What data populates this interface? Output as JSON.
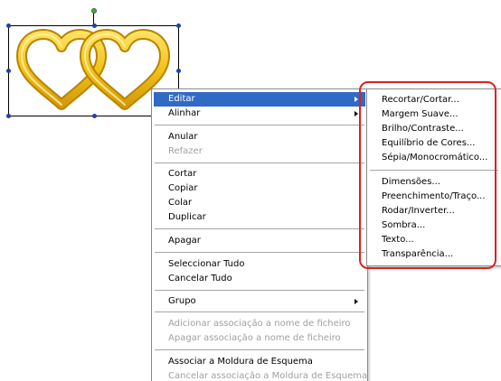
{
  "colors": {
    "highlight": "#316ac5",
    "annotation": "#e0201f",
    "heart_gold": "#f2c21a"
  },
  "canvas_object": {
    "icon": "double-heart-shape"
  },
  "main_menu": {
    "items": [
      {
        "label": "Editar",
        "highlighted": true,
        "submenu": true
      },
      {
        "label": "Alinhar",
        "submenu": true
      },
      {
        "label": "Anular"
      },
      {
        "label": "Refazer",
        "disabled": true
      },
      {
        "label": "Cortar"
      },
      {
        "label": "Copiar"
      },
      {
        "label": "Colar"
      },
      {
        "label": "Duplicar"
      },
      {
        "label": "Apagar"
      },
      {
        "label": "Seleccionar Tudo"
      },
      {
        "label": "Cancelar Tudo"
      },
      {
        "label": "Grupo",
        "submenu": true
      },
      {
        "label": "Adicionar associação a nome de ficheiro",
        "disabled": true
      },
      {
        "label": "Apagar associação a nome de ficheiro",
        "disabled": true
      },
      {
        "label": "Associar a Moldura de Esquema"
      },
      {
        "label": "Cancelar associação a Moldura de Esquema",
        "disabled": true
      }
    ]
  },
  "sub_menu": {
    "items": [
      {
        "label": "Recortar/Cortar..."
      },
      {
        "label": "Margem Suave..."
      },
      {
        "label": "Brilho/Contraste..."
      },
      {
        "label": "Equilíbrio de Cores..."
      },
      {
        "label": "Sépia/Monocromático..."
      },
      {
        "label": "Dimensões..."
      },
      {
        "label": "Preenchimento/Traço..."
      },
      {
        "label": "Rodar/Inverter..."
      },
      {
        "label": "Sombra..."
      },
      {
        "label": "Texto..."
      },
      {
        "label": "Transparência..."
      }
    ]
  }
}
